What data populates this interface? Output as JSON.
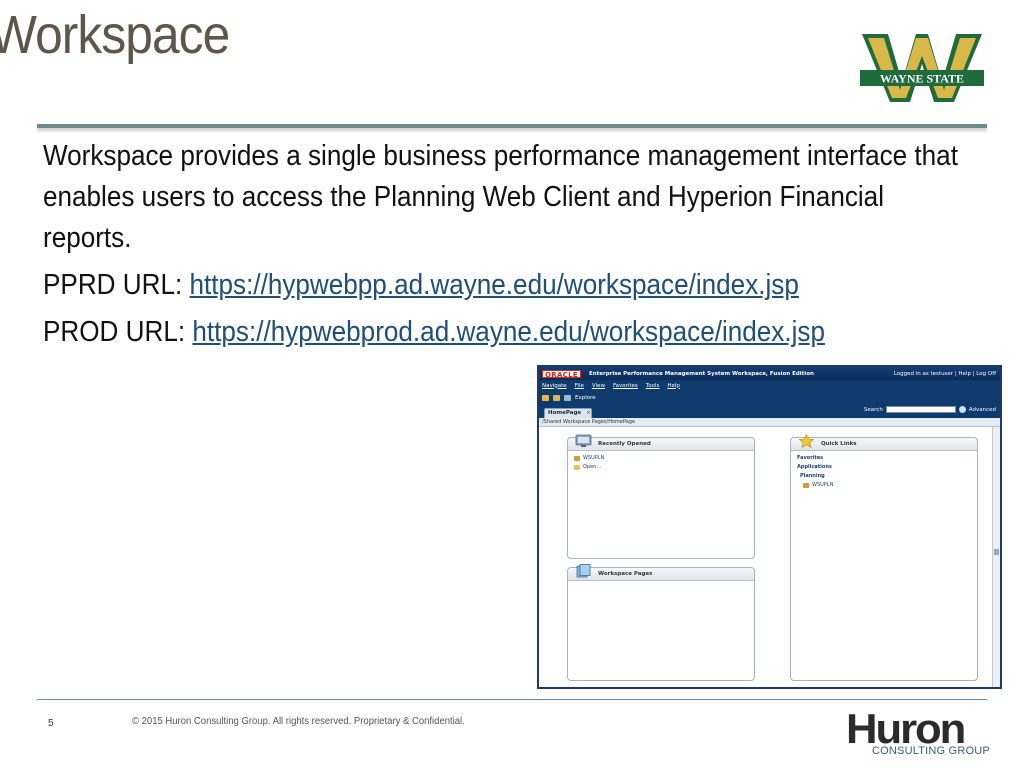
{
  "slide": {
    "title": "Workspace",
    "body_paragraph": "Workspace provides a single business performance management interface that enables users to access the Planning Web Client and Hyperion Financial reports.",
    "pprd_label": "PPRD URL: ",
    "pprd_url": "https://hypwebpp.ad.wayne.edu/workspace/index.jsp",
    "prod_label": "PROD URL: ",
    "prod_url": "https://hypwebprod.ad.wayne.edu/workspace/index.jsp"
  },
  "logo": {
    "text": "WAYNE STATE",
    "colors": {
      "green": "#1f6b3c",
      "gold": "#d9b84a"
    }
  },
  "screenshot": {
    "oracle_logo": "ORACLE",
    "app_title": "Enterprise Performance Management System Workspace, Fusion Edition",
    "login_text": "Logged in as testuser | Help | Log Off",
    "menu": [
      "Navigate",
      "File",
      "View",
      "Favorites",
      "Tools",
      "Help"
    ],
    "toolbar_explore": "Explore",
    "tab_label": "HomePage",
    "tab_close": "×",
    "search_label": "Search",
    "advanced_label": "Advanced",
    "breadcrumb": "/Shared Workspace Pages/HomePage",
    "recently_opened": {
      "title": "Recently Opened",
      "items": [
        "WSUPLN",
        "Open..."
      ]
    },
    "workspace_pages": {
      "title": "Workspace Pages"
    },
    "quick_links": {
      "title": "Quick Links",
      "favorites": "Favorites",
      "applications": "Applications",
      "planning": "Planning",
      "item": "WSUPLN"
    }
  },
  "footer": {
    "page_number": "5",
    "copyright": "© 2015 Huron Consulting Group. All rights reserved. Proprietary & Confidential.",
    "huron_word": "Huron",
    "huron_tagline": "CONSULTING GROUP"
  }
}
